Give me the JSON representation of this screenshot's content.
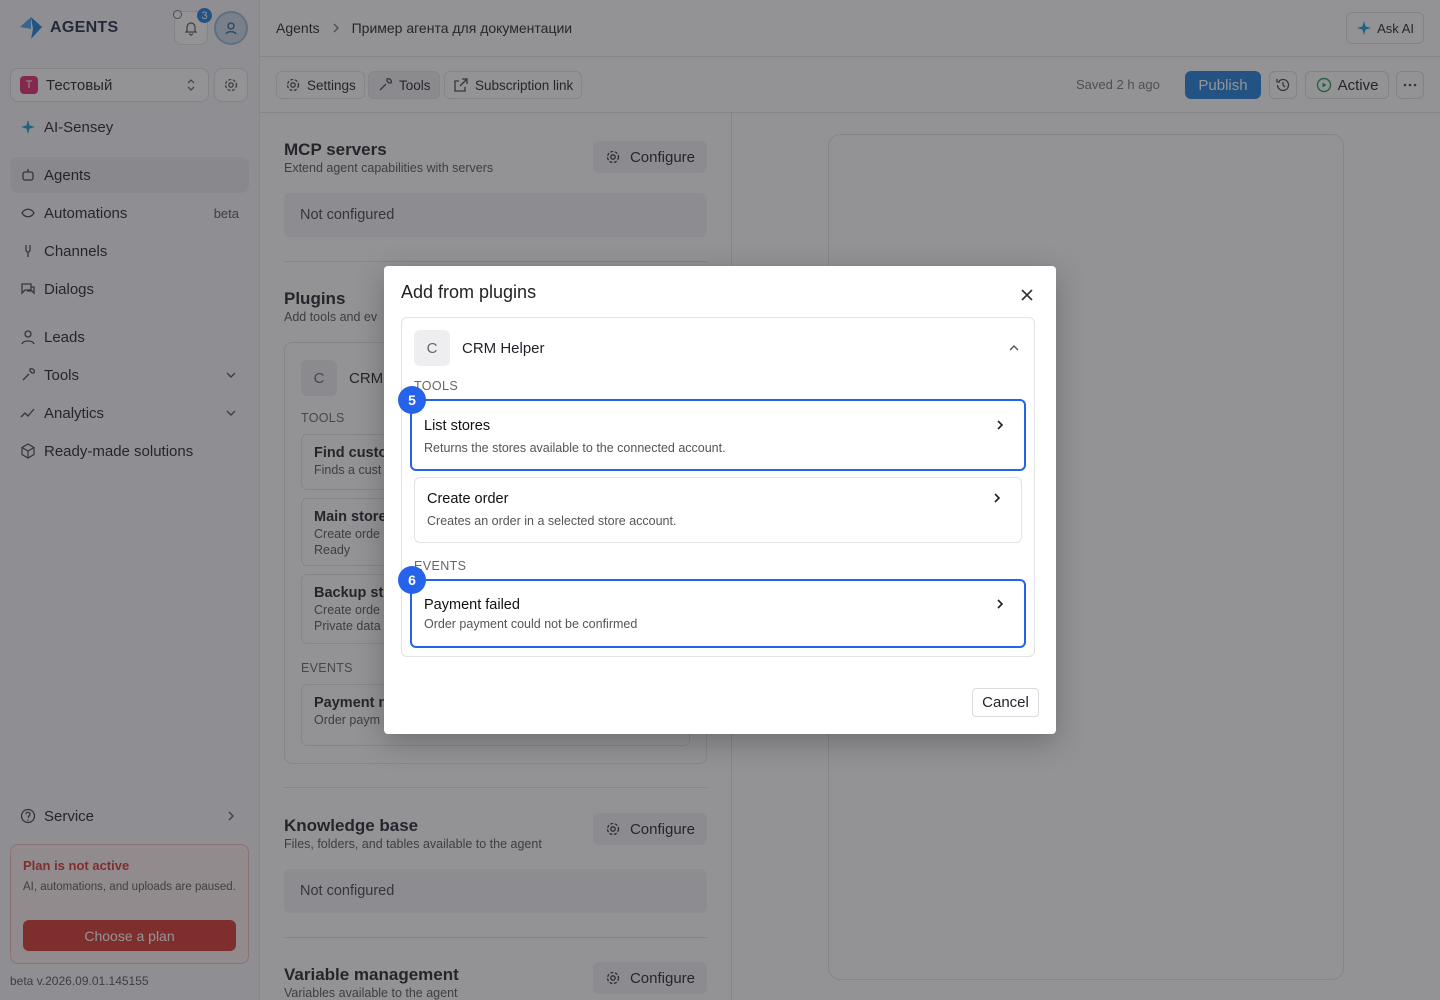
{
  "app": {
    "logo_text": "AGENTS",
    "notification_count": "3"
  },
  "workspace": {
    "initial": "T",
    "name": "Тестовый"
  },
  "sidebar": {
    "ai_item": "AI-Sensey",
    "items": [
      {
        "label": "Agents",
        "active": true
      },
      {
        "label": "Automations",
        "badge": "beta"
      },
      {
        "label": "Channels"
      },
      {
        "label": "Dialogs"
      },
      {
        "label": "Leads"
      },
      {
        "label": "Tools"
      },
      {
        "label": "Analytics"
      },
      {
        "label": "Ready-made solutions"
      }
    ],
    "service": "Service",
    "plan": {
      "title": "Plan is not active",
      "description": "AI, automations, and uploads are paused.",
      "button": "Choose a plan"
    },
    "version": "beta v.2026.09.01.145155"
  },
  "breadcrumb": {
    "root": "Agents",
    "current": "Пример агента для документации"
  },
  "ask_ai": "Ask AI",
  "toolbar": {
    "settings": "Settings",
    "tools": "Tools",
    "subscription": "Subscription link",
    "saved": "Saved 2 h ago",
    "publish": "Publish",
    "status": "Active"
  },
  "content": {
    "mcp": {
      "title": "MCP servers",
      "subtitle": "Extend agent capabilities with servers",
      "configure": "Configure",
      "empty": "Not configured"
    },
    "plugins": {
      "title": "Plugins",
      "subtitle": "Add tools and ev",
      "plugin_initial": "C",
      "plugin_name": "CRM",
      "tools_label": "TOOLS",
      "events_label": "EVENTS",
      "cards": [
        {
          "title": "Find custo",
          "line1": "Finds a cust"
        },
        {
          "title": "Main store",
          "line1": "Create orde",
          "line2": "Ready"
        },
        {
          "title": "Backup st",
          "line1": "Create orde",
          "line2": "Private data"
        }
      ],
      "event_card": {
        "title": "Payment n",
        "line1": "Order paym"
      }
    },
    "knowledge": {
      "title": "Knowledge base",
      "subtitle": "Files, folders, and tables available to the agent",
      "configure": "Configure",
      "empty": "Not configured"
    },
    "variables": {
      "title": "Variable management",
      "subtitle": "Variables available to the agent",
      "configure": "Configure"
    }
  },
  "modal": {
    "title": "Add from plugins",
    "plugin_initial": "C",
    "plugin_name": "CRM Helper",
    "tools_label": "TOOLS",
    "events_label": "EVENTS",
    "tools": [
      {
        "title": "List stores",
        "description": "Returns the stores available to the connected account.",
        "step": "5"
      },
      {
        "title": "Create order",
        "description": "Creates an order in a selected store account."
      }
    ],
    "events": [
      {
        "title": "Payment failed",
        "description": "Order payment could not be confirmed",
        "step": "6"
      }
    ],
    "cancel": "Cancel"
  },
  "colors": {
    "accent": "#1f7fd6",
    "highlight": "#2563eb",
    "danger": "#d6342e",
    "workspace": "#e0286e"
  },
  "icons": [
    "logo-icon",
    "bell-icon",
    "user-icon",
    "chevron-updown-icon",
    "gear-icon",
    "sparkle-icon",
    "agents-icon",
    "automations-icon",
    "channels-icon",
    "dialogs-icon",
    "leads-icon",
    "tools-icon",
    "analytics-icon",
    "solutions-icon",
    "help-icon",
    "chevron-right-icon",
    "chevron-down-icon",
    "chevron-up-icon",
    "history-icon",
    "play-icon",
    "more-icon",
    "external-link-icon",
    "close-icon"
  ]
}
